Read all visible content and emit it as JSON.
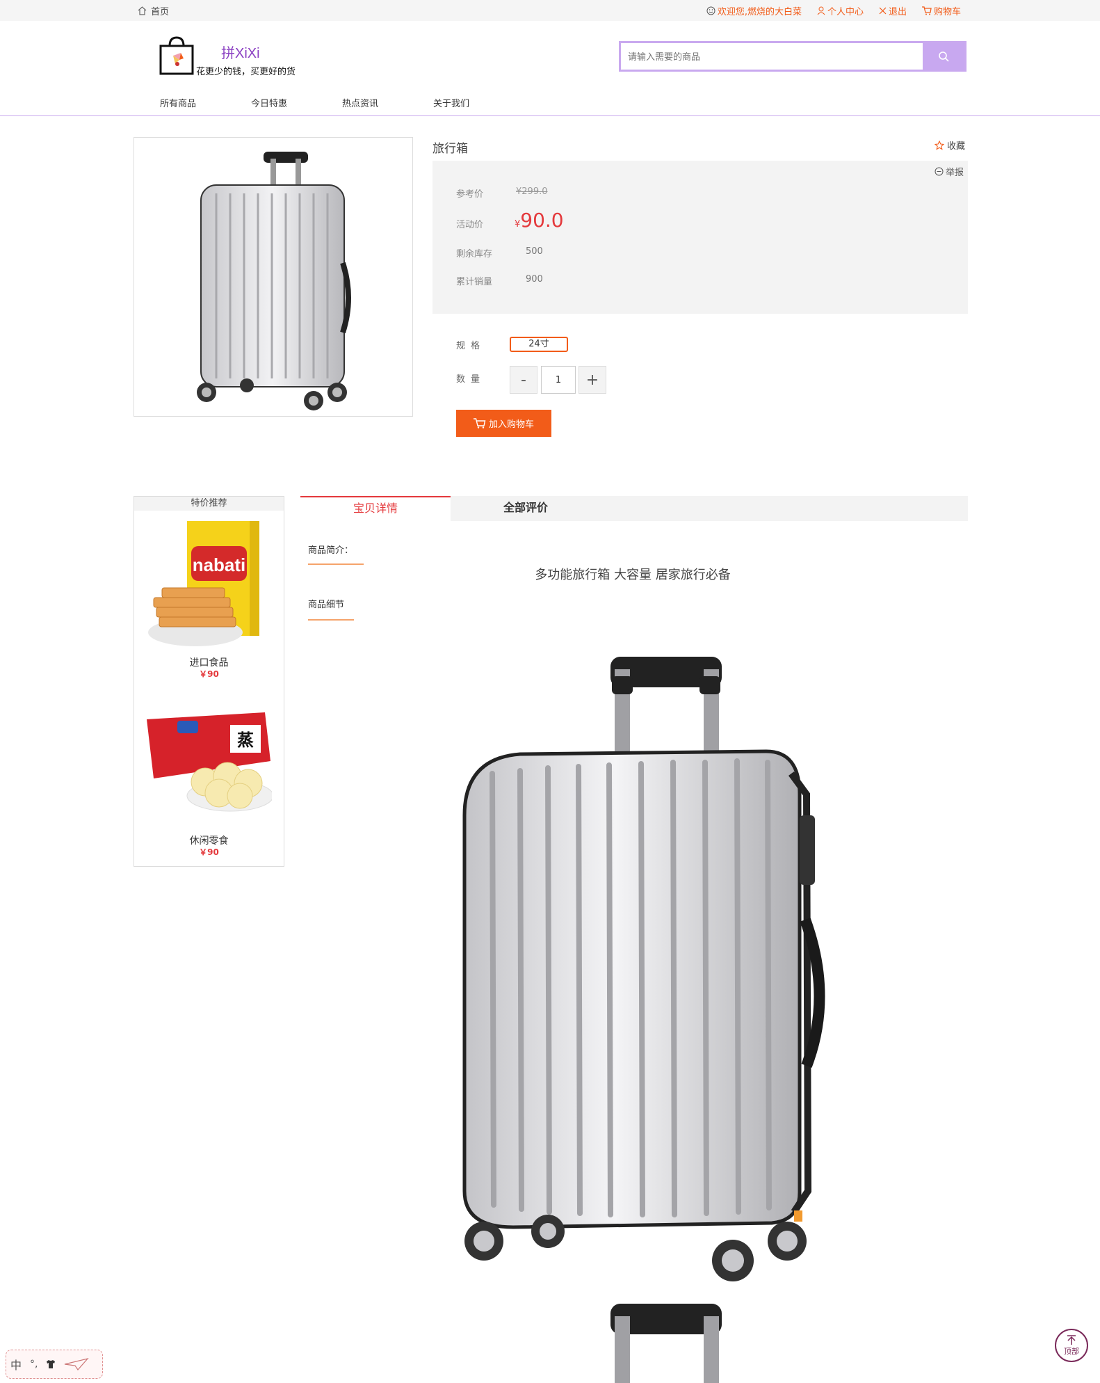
{
  "topbar": {
    "home": "首页",
    "welcome": "欢迎您,燃烧的大白菜",
    "user_center": "个人中心",
    "logout": "退出",
    "cart": "购物车"
  },
  "header": {
    "logo_brand": "拼XiXi",
    "logo_slogan": "花更少的钱，买更好的货",
    "search_placeholder": "请输入需要的商品"
  },
  "nav": [
    "所有商品",
    "今日特惠",
    "热点资讯",
    "关于我们"
  ],
  "product": {
    "title": "旅行箱",
    "favorite": "收藏",
    "report": "举报",
    "ref_price_label": "参考价",
    "ref_price": "¥299.0",
    "promo_price_label": "活动价",
    "currency": "¥",
    "promo_price": "90.0",
    "stock_label": "剩余库存",
    "stock": "500",
    "sales_label": "累计销量",
    "sales": "900",
    "spec_label": "规格",
    "spec_value": "24寸",
    "qty_label": "数量",
    "qty": "1",
    "minus": "-",
    "plus": "+",
    "add_to_cart": "加入购物车"
  },
  "recommend": {
    "title": "特价推荐",
    "items": [
      {
        "name": "进口食品",
        "price": "￥90"
      },
      {
        "name": "休闲零食",
        "price": "￥90"
      }
    ]
  },
  "tabs": {
    "detail": "宝贝详情",
    "reviews": "全部评价"
  },
  "detail": {
    "intro_label": "商品简介：",
    "description": "多功能旅行箱 大容量 居家旅行必备",
    "detail_label": "商品细节"
  },
  "floating": {
    "ime": "中",
    "to_top": "顶部"
  },
  "colors": {
    "accent": "#f25c19",
    "price": "#e4393c",
    "search_border": "#c9a9ef"
  }
}
